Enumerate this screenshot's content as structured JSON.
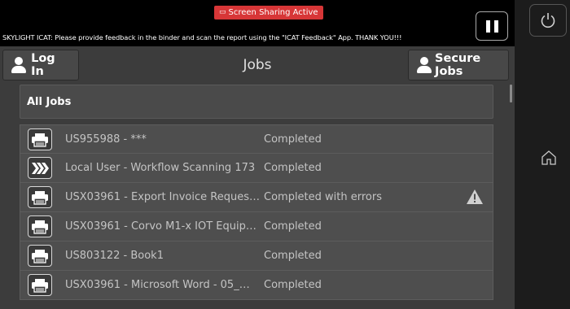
{
  "banner": {
    "screen_sharing": "Screen Sharing Active",
    "message": "SKYLIGHT ICAT: Please provide feedback in the binder and scan the report using the \"ICAT Feedback\" App.  THANK YOU!!!"
  },
  "header": {
    "login_label": "Log In",
    "title": "Jobs",
    "secure_label": "Secure Jobs"
  },
  "filter": {
    "label": "All Jobs"
  },
  "jobs": [
    {
      "name": "US955988 - ***",
      "status": "Completed",
      "icon": "printer-icon",
      "warning": false
    },
    {
      "name": "Local User - Workflow Scanning 173",
      "status": "Completed",
      "icon": "workflow-scan-icon",
      "warning": false
    },
    {
      "name": "USX03961 - Export Invoice Reques…",
      "status": "Completed with errors",
      "icon": "printer-icon",
      "warning": true
    },
    {
      "name": "USX03961 - Corvo M1-x IOT Equip…",
      "status": "Completed",
      "icon": "printer-icon",
      "warning": false
    },
    {
      "name": "US803122 - Book1",
      "status": "Completed",
      "icon": "printer-icon",
      "warning": false
    },
    {
      "name": "USX03961 - Microsoft Word - 05_…",
      "status": "Completed",
      "icon": "printer-icon",
      "warning": false
    }
  ],
  "colors": {
    "share_badge": "#d73637",
    "background": "#3c3c3c",
    "row": "#4e4e4e"
  }
}
